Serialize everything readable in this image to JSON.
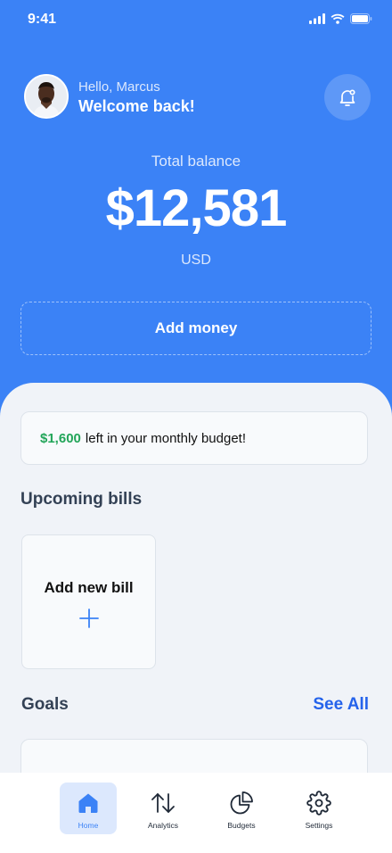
{
  "status_bar": {
    "time": "9:41"
  },
  "header": {
    "greeting": "Hello, Marcus",
    "welcome": "Welcome back!"
  },
  "balance": {
    "label": "Total balance",
    "amount": "$12,581",
    "currency": "USD"
  },
  "actions": {
    "add_money": "Add money"
  },
  "budget_notice": {
    "amount": "$1,600",
    "text": "left in your monthly budget!"
  },
  "upcoming_bills": {
    "title": "Upcoming bills",
    "add_new_label": "Add new bill"
  },
  "goals": {
    "title": "Goals",
    "see_all": "See All"
  },
  "tab_bar": {
    "tabs": [
      {
        "label": "Home",
        "icon": "home-icon",
        "active": true
      },
      {
        "label": "Analytics",
        "icon": "arrows-up-down-icon",
        "active": false
      },
      {
        "label": "Budgets",
        "icon": "pie-chart-icon",
        "active": false
      },
      {
        "label": "Settings",
        "icon": "gear-icon",
        "active": false
      }
    ]
  },
  "colors": {
    "primary": "#3B82F6",
    "background": "#F0F3F8",
    "positive": "#22A559",
    "link": "#2563EB"
  }
}
